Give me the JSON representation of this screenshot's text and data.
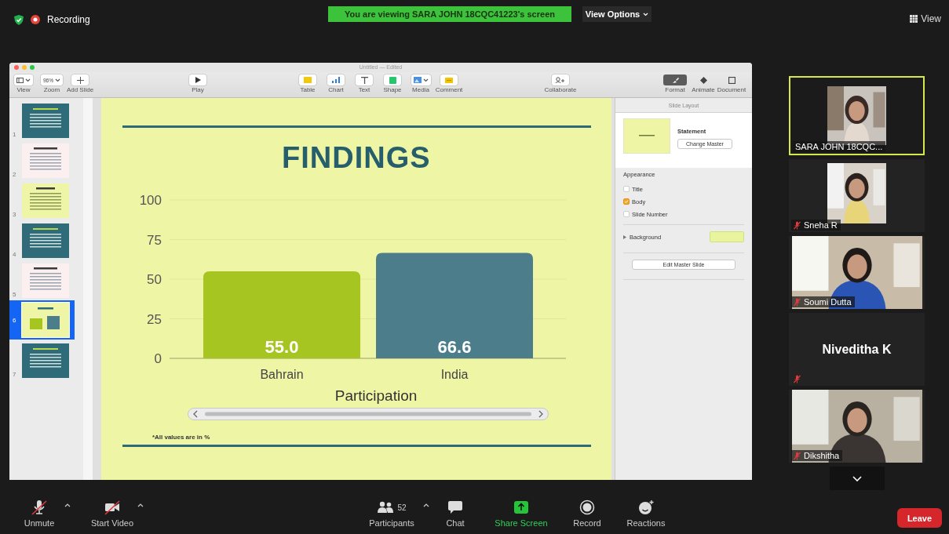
{
  "meeting_bar": {
    "recording": "Recording",
    "banner": "You are viewing SARA JOHN 18CQC41223's screen",
    "view_options": "View Options",
    "view": "View"
  },
  "keynote": {
    "title": "Untitled — Edited",
    "toolbar_groups": [
      {
        "items": [
          {
            "kind": "view",
            "label": "View"
          },
          {
            "kind": "zoom",
            "label": "Zoom",
            "value": "96%"
          },
          {
            "kind": "add",
            "label": "Add Slide"
          }
        ]
      },
      {
        "items": [
          {
            "kind": "play",
            "label": "Play"
          }
        ]
      },
      {
        "items": [
          {
            "kind": "table",
            "label": "Table"
          },
          {
            "kind": "chart",
            "label": "Chart"
          },
          {
            "kind": "text",
            "label": "Text"
          },
          {
            "kind": "shape",
            "label": "Shape"
          },
          {
            "kind": "media",
            "label": "Media"
          },
          {
            "kind": "comment",
            "label": "Comment"
          }
        ]
      },
      {
        "items": [
          {
            "kind": "collaborate",
            "label": "Collaborate"
          }
        ]
      },
      {
        "items": [
          {
            "kind": "format",
            "label": "Format",
            "selected": true
          },
          {
            "kind": "animate",
            "label": "Animate",
            "selected": false
          },
          {
            "kind": "document",
            "label": "Document",
            "selected": false
          }
        ]
      }
    ],
    "slides": [
      {
        "number": "1",
        "kind": "teal",
        "selected": false
      },
      {
        "number": "2",
        "kind": "blush",
        "selected": false
      },
      {
        "number": "3",
        "kind": "lime",
        "selected": false
      },
      {
        "number": "4",
        "kind": "teal",
        "selected": false
      },
      {
        "number": "5",
        "kind": "blush",
        "selected": false
      },
      {
        "number": "6",
        "kind": "chart",
        "selected": true
      },
      {
        "number": "7",
        "kind": "teal",
        "selected": false
      }
    ],
    "slide": {
      "title": "FINDINGS",
      "footnote": "*All values are in %",
      "chart_data": {
        "type": "bar",
        "xlabel": "Participation",
        "categories": [
          "Bahrain",
          "India"
        ],
        "values": [
          55.0,
          66.6
        ],
        "ylim": [
          0,
          100
        ],
        "grid": true,
        "yticks": [
          0,
          25,
          50,
          75,
          100
        ],
        "value_labels": [
          "55.0",
          "66.6"
        ]
      }
    },
    "inspector": {
      "header": "Slide Layout",
      "layout_name": "Statement",
      "change_master": "Change Master",
      "appearance": "Appearance",
      "options": [
        {
          "label": "Title",
          "checked": false
        },
        {
          "label": "Body",
          "checked": true
        },
        {
          "label": "Slide Number",
          "checked": false
        }
      ],
      "background": "Background",
      "edit_master": "Edit Master Slide"
    }
  },
  "participants": [
    {
      "name": "SARA JOHN 18CQC...",
      "kind": "portrait-video",
      "muted": false,
      "active": true
    },
    {
      "name": "Sneha R",
      "kind": "portrait-video",
      "muted": true,
      "active": false
    },
    {
      "name": "Soumi Dutta",
      "kind": "landscape-video",
      "muted": true,
      "active": false
    },
    {
      "name": "Niveditha K",
      "kind": "no-video",
      "muted": true,
      "active": false
    },
    {
      "name": "Dikshitha",
      "kind": "landscape-video",
      "muted": true,
      "active": false
    }
  ],
  "controls": [
    {
      "kind": "mic",
      "label": "Unmute",
      "off": true,
      "caret": true
    },
    {
      "kind": "video",
      "label": "Start Video",
      "off": true,
      "caret": true
    },
    {
      "kind": "participants",
      "label": "Participants",
      "count": "52",
      "caret": true
    },
    {
      "kind": "chat",
      "label": "Chat",
      "caret": false
    },
    {
      "kind": "share",
      "label": "Share Screen",
      "caret": false
    },
    {
      "kind": "record",
      "label": "Record",
      "caret": false
    },
    {
      "kind": "reactions",
      "label": "Reactions",
      "caret": false
    }
  ],
  "leave": "Leave"
}
